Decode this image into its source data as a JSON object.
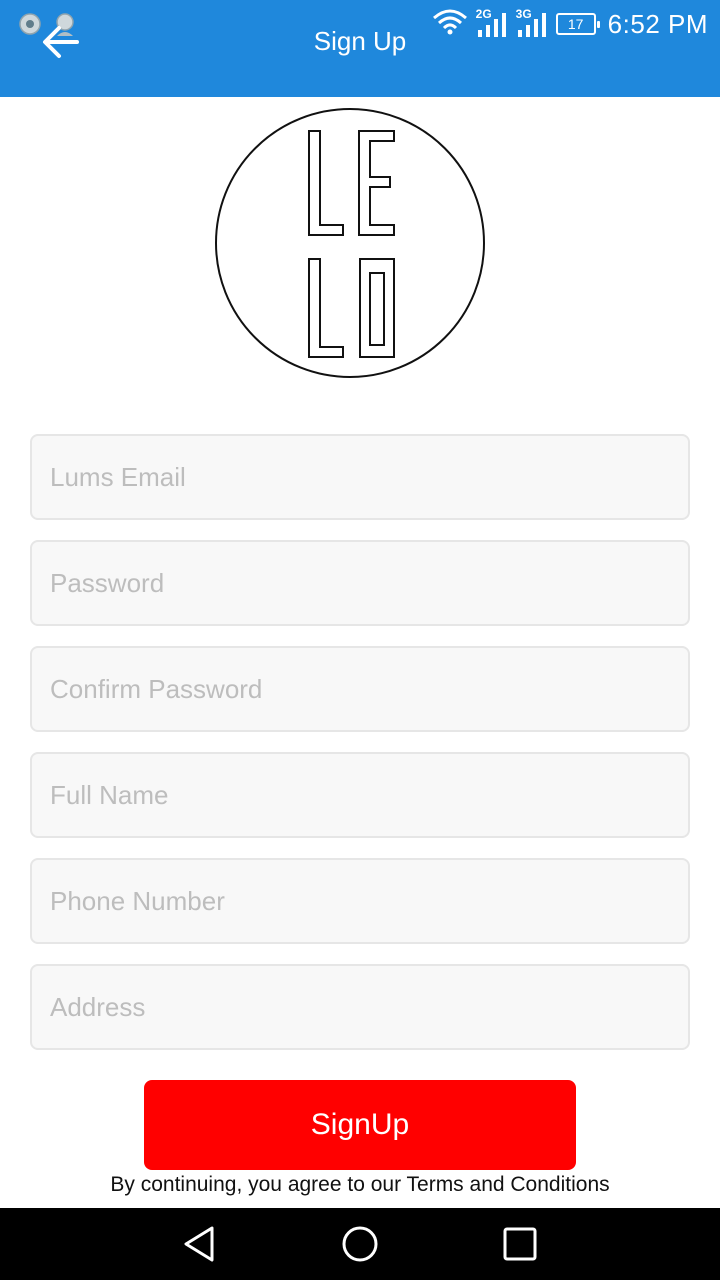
{
  "status_bar": {
    "time": "6:52 PM",
    "battery_level": "17",
    "network_1": "2G",
    "network_2": "3G",
    "icons": [
      "vpn-key-icon",
      "search-notification-icon",
      "wifi-icon",
      "signal-2g-icon",
      "signal-3g-icon",
      "battery-icon"
    ]
  },
  "app_bar": {
    "title": "Sign Up",
    "back_icon": "arrow-left-icon",
    "color": "#1f88dc"
  },
  "logo": {
    "icon": "lelo-logo"
  },
  "form": {
    "email_placeholder": "Lums Email",
    "password_placeholder": "Password",
    "confirm_password_placeholder": "Confirm Password",
    "full_name_placeholder": "Full Name",
    "phone_placeholder": "Phone Number",
    "address_placeholder": "Address"
  },
  "signup_button": {
    "label": "SignUp",
    "color": "#ff0000"
  },
  "terms_text": "By continuing, you agree to our Terms and Conditions",
  "nav_bar": {
    "icons": [
      "back-triangle-icon",
      "home-circle-icon",
      "recents-square-icon"
    ]
  }
}
